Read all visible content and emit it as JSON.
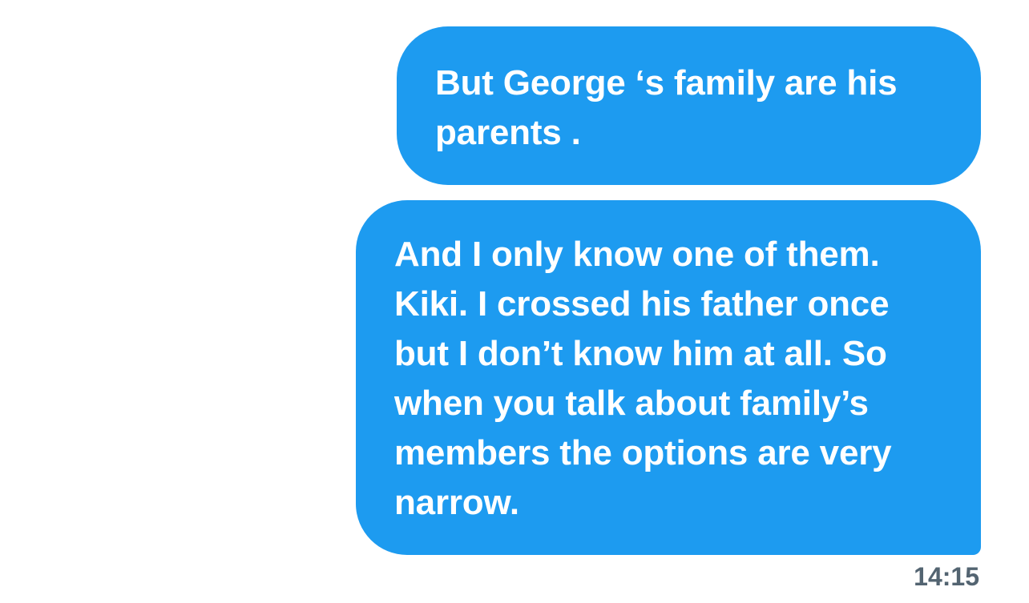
{
  "messages": [
    {
      "sender": "self",
      "text": "But George ‘s family are his parents ."
    },
    {
      "sender": "self",
      "text": "And I only know one of them. Kiki. I crossed his father once but I don’t know him at all. So when you talk about family’s members the options are very narrow."
    }
  ],
  "timestamp": "14:15",
  "colors": {
    "bubble": "#1d9bf0",
    "bubble_text": "#ffffff",
    "timestamp": "#536471",
    "background": "#ffffff"
  }
}
